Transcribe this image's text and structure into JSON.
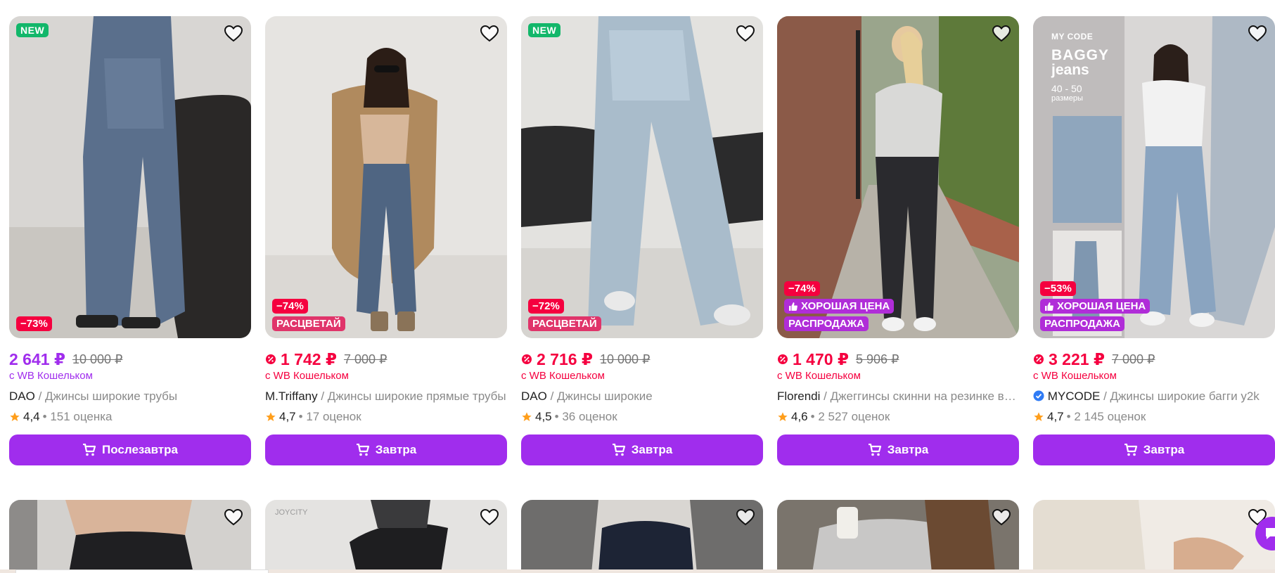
{
  "colors": {
    "accent": "#a02ded",
    "discount": "#f5003f",
    "new_badge": "#12b76a",
    "promo_badge": "#e0346a",
    "good_price_badge": "#b02dd8",
    "star": "#ff9e1b"
  },
  "products": [
    {
      "new_badge": "NEW",
      "badges": [
        "−73%"
      ],
      "price": "2 641 ₽",
      "old_price": "10 000 ₽",
      "wallet": "с WB Кошельком",
      "brand": "DAO",
      "name": "/ Джинсы широкие трубы",
      "rating": "4,4",
      "reviews": "• 151 оценка",
      "delivery": "Послезавтра",
      "price_color": "purple",
      "verified": false
    },
    {
      "new_badge": "",
      "badges": [
        "−74%",
        "РАСЦВЕТАЙ"
      ],
      "price": "1 742 ₽",
      "old_price": "7 000 ₽",
      "wallet": "с WB Кошельком",
      "brand": "M.Triffany",
      "name": "/ Джинсы широкие прямые трубы",
      "rating": "4,7",
      "reviews": "• 17 оценок",
      "delivery": "Завтра",
      "price_color": "red",
      "verified": false
    },
    {
      "new_badge": "NEW",
      "badges": [
        "−72%",
        "РАСЦВЕТАЙ"
      ],
      "price": "2 716 ₽",
      "old_price": "10 000 ₽",
      "wallet": "с WB Кошельком",
      "brand": "DAO",
      "name": "/ Джинсы широкие",
      "rating": "4,5",
      "reviews": "• 36 оценок",
      "delivery": "Завтра",
      "price_color": "red",
      "verified": false
    },
    {
      "new_badge": "",
      "badges": [
        "−74%",
        "ХОРОШАЯ ЦЕНА",
        "РАСПРОДАЖА"
      ],
      "price": "1 470 ₽",
      "old_price": "5 906 ₽",
      "wallet": "с WB Кошельком",
      "brand": "Florendi",
      "name": "/ Джеггинсы скинни на резинке высокая посадка",
      "rating": "4,6",
      "reviews": "• 2 527 оценок",
      "delivery": "Завтра",
      "price_color": "red",
      "verified": false
    },
    {
      "new_badge": "",
      "badges": [
        "−53%",
        "ХОРОШАЯ ЦЕНА",
        "РАСПРОДАЖА"
      ],
      "price": "3 221 ₽",
      "old_price": "7 000 ₽",
      "wallet": "с WB Кошельком",
      "brand": "MYCODE",
      "name": "/ Джинсы широкие багги y2k",
      "rating": "4,7",
      "reviews": "• 2 145 оценок",
      "delivery": "Завтра",
      "price_color": "red",
      "verified": true
    }
  ],
  "product5_ad": {
    "logo": "MY CODE",
    "headline1": "BAGGY",
    "headline2": "jeans",
    "sizes": "40 - 50",
    "sizes_label": "размеры"
  },
  "row2_watermark": "JOYCITY",
  "icons": {
    "favorite": "heart-icon",
    "cart": "cart-icon",
    "wallet": "wallet-discount-icon",
    "star": "star-icon",
    "good_price": "thumbs-up-icon",
    "verified": "verified-check-icon",
    "chat": "chat-icon"
  }
}
